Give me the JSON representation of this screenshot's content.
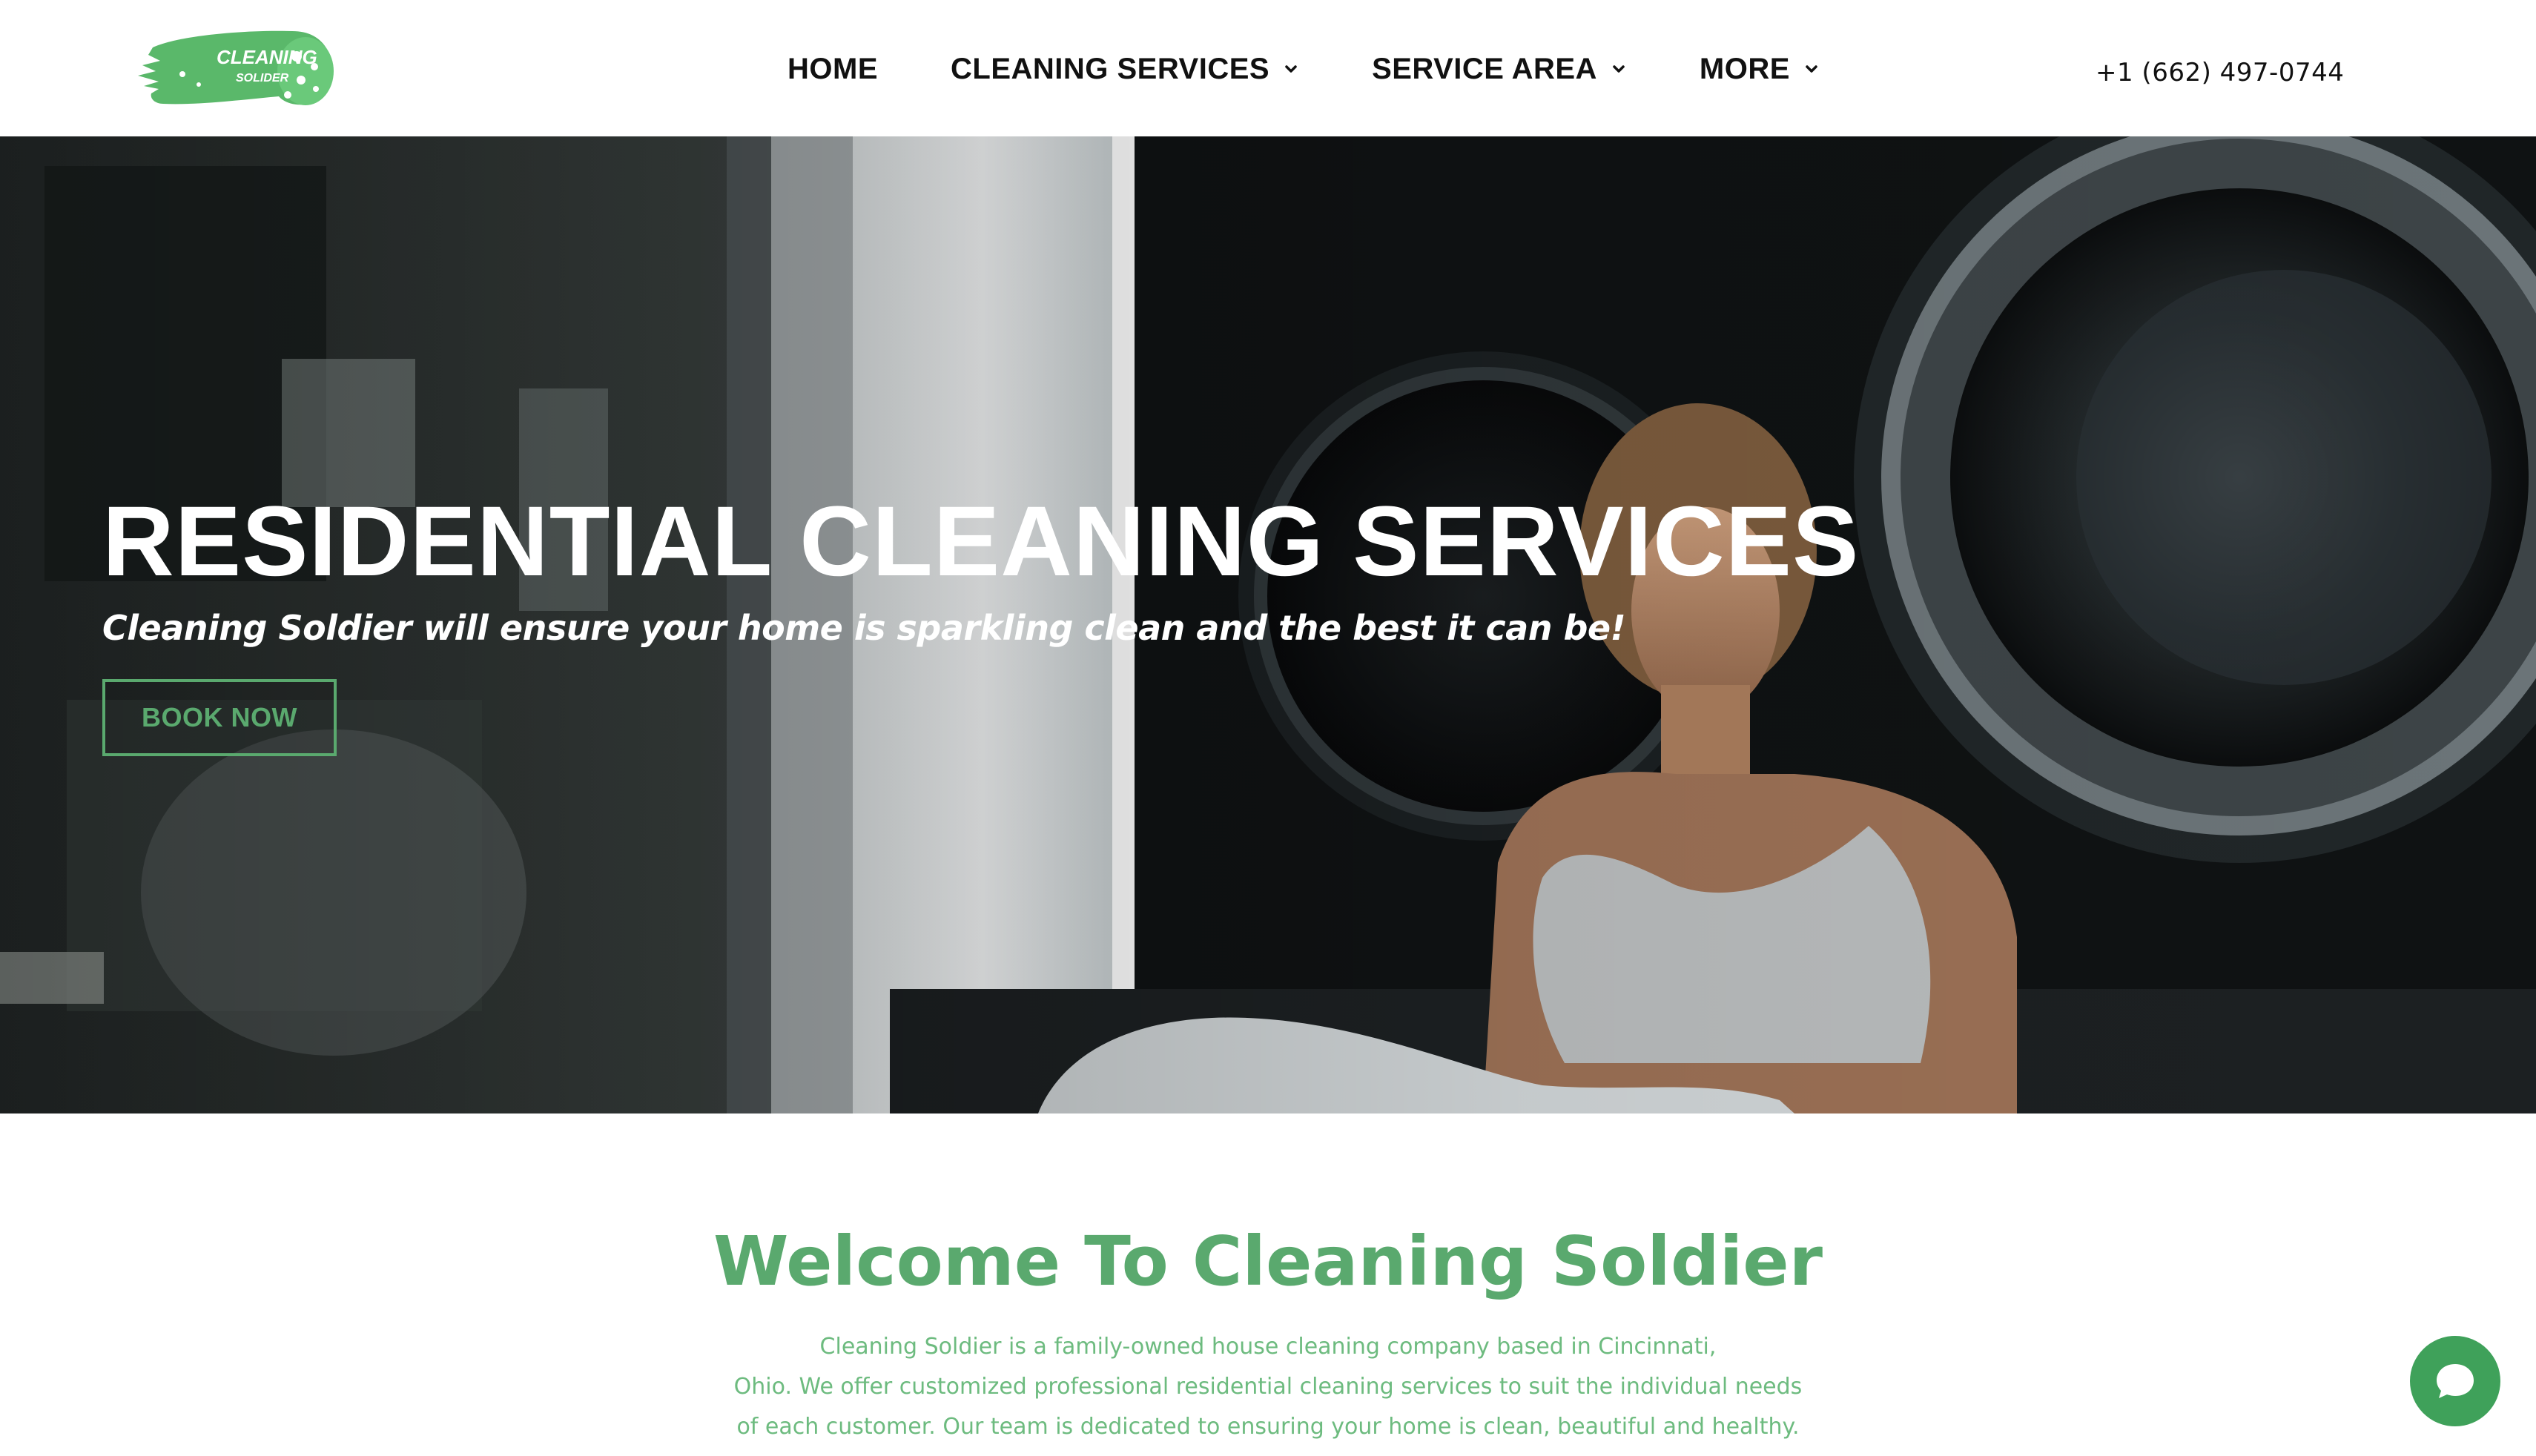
{
  "brand": {
    "logo_line1": "CLEANING",
    "logo_line2": "SOLIDER",
    "logo_icon": "sponge-logo-icon",
    "accent_color": "#5aa96e"
  },
  "nav": {
    "items": [
      {
        "label": "HOME",
        "has_dropdown": false
      },
      {
        "label": "CLEANING SERVICES",
        "has_dropdown": true
      },
      {
        "label": "SERVICE AREA",
        "has_dropdown": true
      },
      {
        "label": "MORE",
        "has_dropdown": true
      }
    ],
    "dropdown_icon": "chevron-down-icon"
  },
  "header": {
    "phone": "+1 (662) 497-0744"
  },
  "hero": {
    "title": "RESIDENTIAL CLEANING SERVICES",
    "subtitle": "Cleaning Soldier will ensure your home is sparkling clean and the best it can be!",
    "cta_label": "BOOK NOW",
    "background": "photo of woman sitting by laundromat washing machines"
  },
  "welcome": {
    "title": "Welcome To Cleaning Soldier",
    "lines": [
      "Cleaning Soldier is a family-owned house cleaning company based in Cincinnati,",
      "Ohio. We offer customized professional residential cleaning services to suit the individual needs",
      "of each customer. Our team is dedicated to ensuring your home is clean, beautiful and healthy."
    ]
  },
  "chat": {
    "icon": "chat-bubble-icon",
    "color": "#3fa15a"
  }
}
